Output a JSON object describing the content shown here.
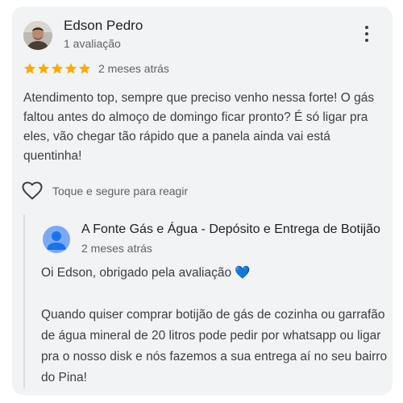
{
  "review": {
    "author_name": "Edson Pedro",
    "author_reviews": "1 avaliação",
    "rating": 5,
    "date": "2 meses atrás",
    "text": "Atendimento top, sempre que preciso venho nessa forte! O gás faltou antes do almoço de domingo ficar pronto? É só ligar pra eles, vão chegar tão rápido que a panela ainda vai está quentinha!",
    "react_label": "Toque e segure para reagir"
  },
  "reply": {
    "owner_name": "A Fonte Gás e Água - Depósito e Entrega de Botijão",
    "date": "2 meses atrás",
    "line1": "Oi Edson, obrigado pela avaliação 💙",
    "line2": "Quando quiser comprar botijão de gás de cozinha ou garrafão de água mineral de 20 litros pode pedir por whatsapp ou ligar pra o nosso disk e nós fazemos a sua entrega aí no seu bairro do Pina!"
  },
  "colors": {
    "star": "#f9ab00",
    "card_bg": "#f1f3f4",
    "owner_avatar": "#7aaaf5",
    "heart_emoji": "#1a73e8"
  },
  "icons": {
    "more": "more-vert-icon",
    "react": "heart-outline-icon",
    "owner_avatar": "person-icon",
    "star": "star-icon"
  }
}
